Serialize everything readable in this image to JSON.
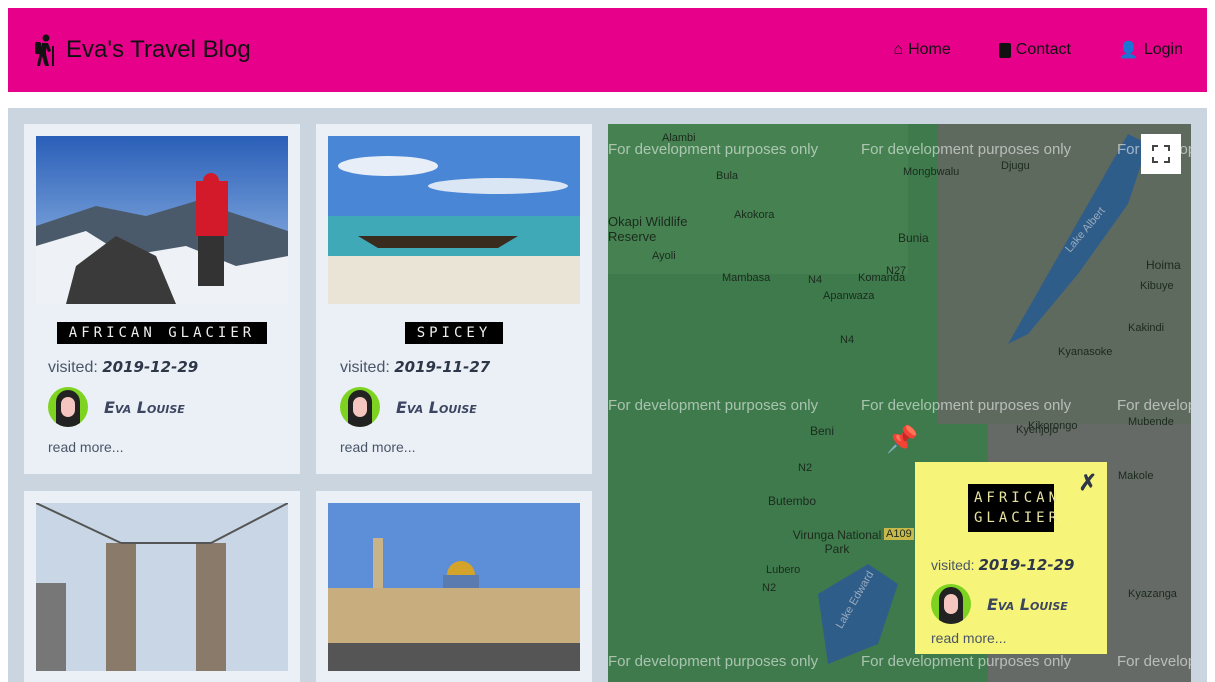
{
  "header": {
    "title": "Eva's Travel Blog",
    "brand_color": "#e6008a",
    "nav": [
      {
        "label": "Home",
        "icon": "home-icon"
      },
      {
        "label": "Contact",
        "icon": "contact-card-icon"
      },
      {
        "label": "Login",
        "icon": "user-lock-icon"
      }
    ]
  },
  "posts": [
    {
      "title": "AFRICAN GLACIER",
      "visited_label": "visited:",
      "date": "2019-12-29",
      "author": "Eva Louise",
      "read_more": "read more..."
    },
    {
      "title": "SPICEY",
      "visited_label": "visited:",
      "date": "2019-11-27",
      "author": "Eva Louise",
      "read_more": "read more..."
    },
    {
      "title": "",
      "visited_label": "",
      "date": "",
      "author": "",
      "read_more": ""
    },
    {
      "title": "",
      "visited_label": "",
      "date": "",
      "author": "",
      "read_more": ""
    }
  ],
  "map": {
    "watermark": "For development purposes only",
    "labels": [
      "Alambi",
      "Bula",
      "Djugu",
      "Mongbwalu",
      "Okapi Wildlife Reserve",
      "Akokora",
      "Bunia",
      "Ayoli",
      "Mambasa",
      "N4",
      "Komanda",
      "N27",
      "Hoima",
      "Apanwaza",
      "Kibuye",
      "Kakindi",
      "N4",
      "Kyanasoke",
      "Beni",
      "Kikorongo",
      "Kyenjojo",
      "Mubende",
      "N2",
      "Butembo",
      "Virunga National Park",
      "Makole",
      "Lubero",
      "N2",
      "Kyazanga",
      "Lake Albert",
      "Lake Edward",
      "A109"
    ],
    "popup": {
      "title": "AFRICAN GLACIER",
      "visited_label": "visited:",
      "date": "2019-12-29",
      "author": "Eva Louise",
      "read_more": "read more...",
      "close": "✗"
    }
  }
}
